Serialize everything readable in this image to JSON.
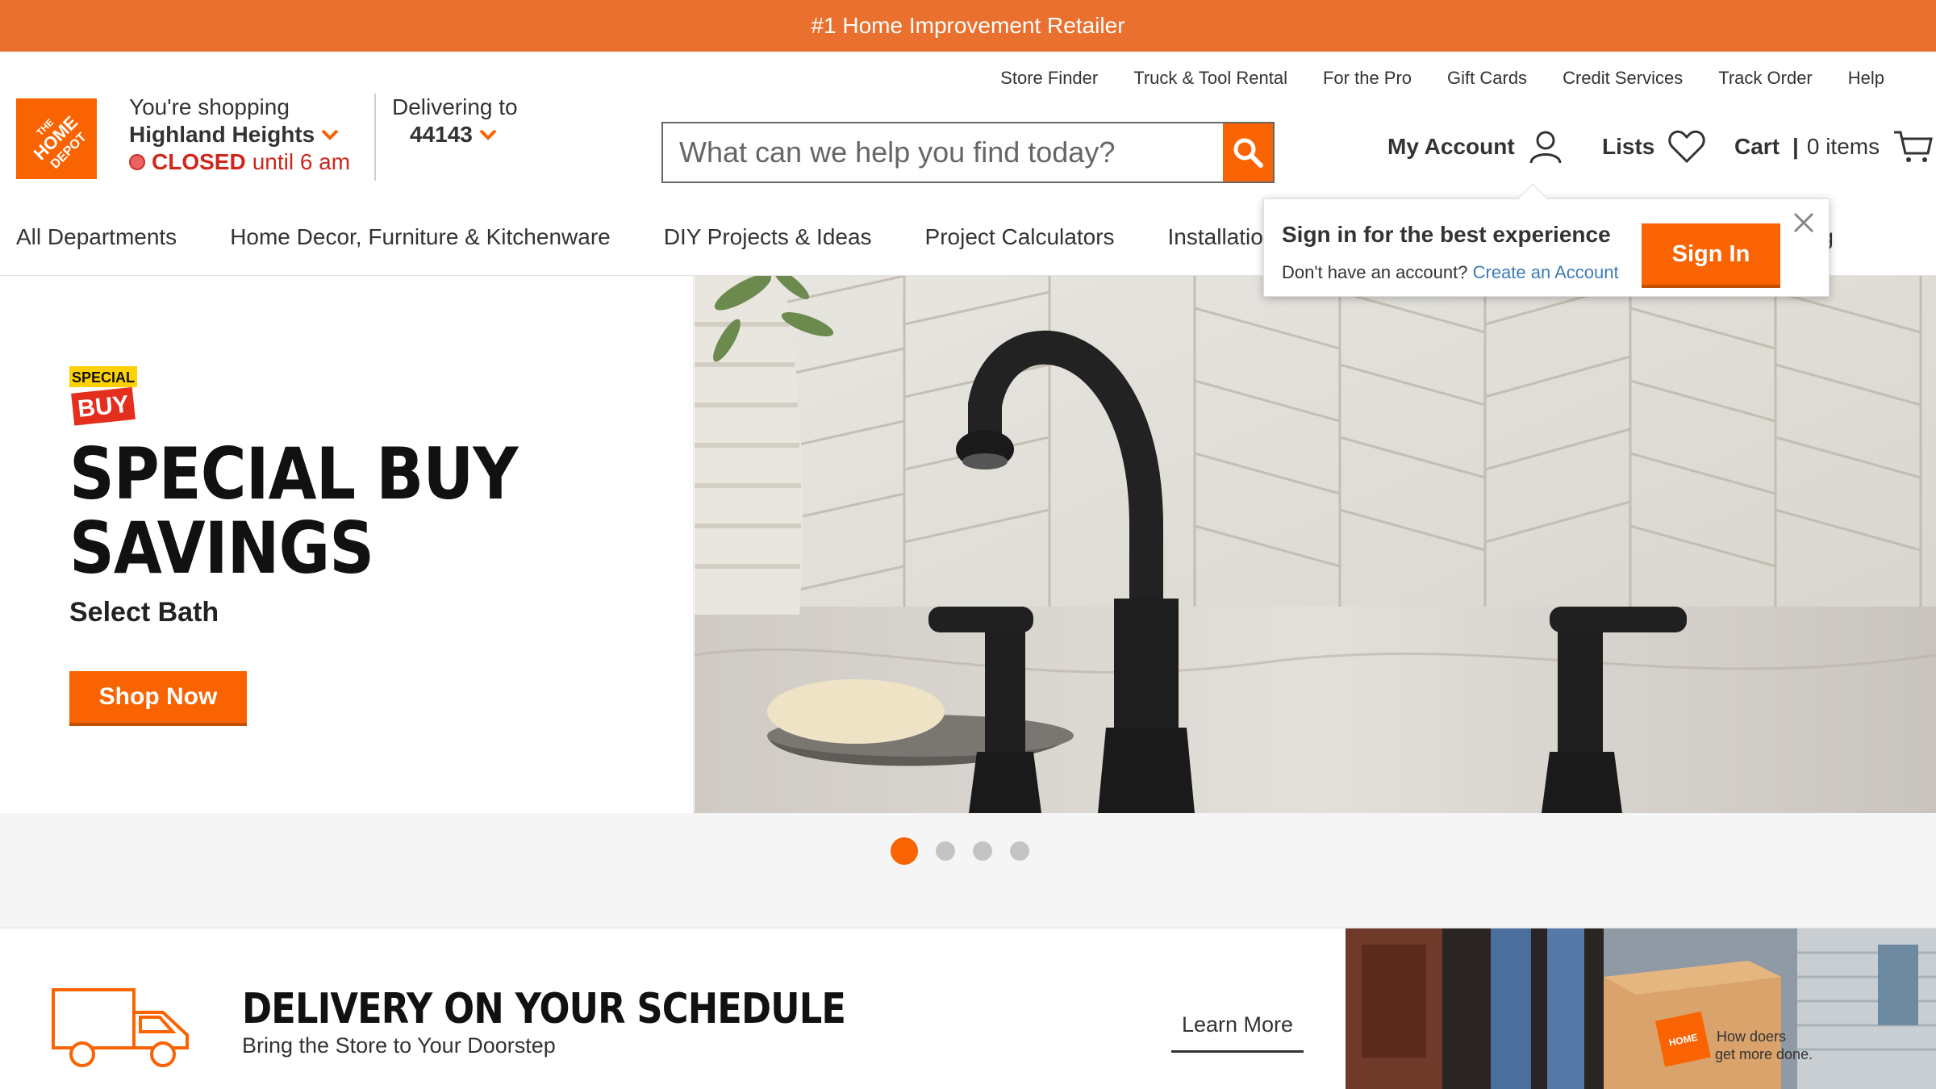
{
  "promo": {
    "text": "#1 Home Improvement Retailer"
  },
  "store": {
    "label": "You're shopping",
    "name": "Highland Heights",
    "status_closed": "CLOSED",
    "status_until": "until 6 am"
  },
  "delivery": {
    "label": "Delivering to",
    "zip": "44143"
  },
  "utility_links": [
    "Store Finder",
    "Truck & Tool Rental",
    "For the Pro",
    "Gift Cards",
    "Credit Services",
    "Track Order",
    "Help"
  ],
  "search": {
    "placeholder": "What can we help you find today?"
  },
  "account": {
    "my_account": "My Account",
    "lists": "Lists",
    "cart": "Cart",
    "cart_sep": "|",
    "cart_count": "0 items"
  },
  "nav": [
    "All Departments",
    "Home Decor, Furniture & Kitchenware",
    "DIY Projects & Ideas",
    "Project Calculators",
    "Installatio",
    "alog"
  ],
  "popover": {
    "title": "Sign in for the best experience",
    "prompt": "Don't have an account?",
    "create_link": "Create an Account",
    "button": "Sign In"
  },
  "hero": {
    "badge_top": "SPECIAL",
    "badge_bottom": "BUY",
    "title": "SPECIAL BUY\nSAVINGS",
    "subtitle": "Select Bath",
    "button": "Shop Now"
  },
  "carousel": {
    "count": 4,
    "active_index": 0
  },
  "delivery_banner": {
    "title": "DELIVERY ON YOUR SCHEDULE",
    "subtitle": "Bring the Store to Your Doorstep",
    "link": "Learn More",
    "box_text_1": "How doers",
    "box_text_2": "get more done."
  },
  "colors": {
    "brand_orange": "#f96302",
    "promo_orange": "#e9702e",
    "closed_red": "#d0261b",
    "link_blue": "#3e7bb6"
  },
  "icons": {
    "logo": "home-depot-logo",
    "search": "search-icon",
    "account": "user-icon",
    "lists": "heart-icon",
    "cart": "cart-icon",
    "close": "close-icon",
    "truck": "truck-icon"
  }
}
